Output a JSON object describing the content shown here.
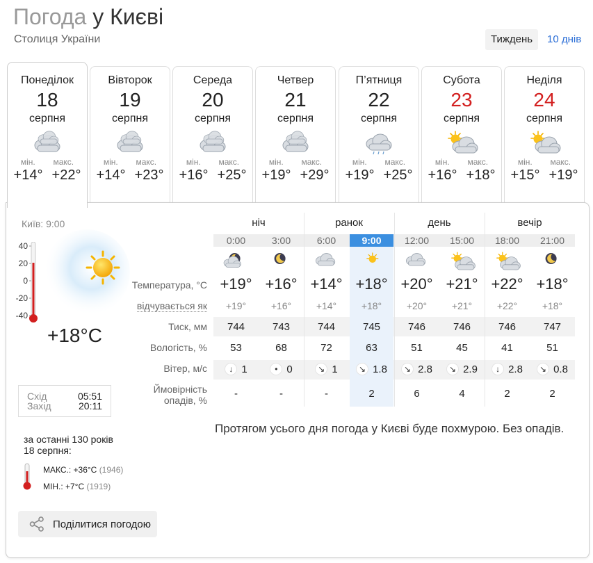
{
  "header": {
    "title_part1": "Погода",
    "title_part2": "у Києві",
    "subtitle": "Столиця України",
    "view_week": "Тиждень",
    "view_10days": "10 днів"
  },
  "days": [
    {
      "name": "Понеділок",
      "num": "18",
      "month": "серпня",
      "min_label": "мін.",
      "max_label": "макс.",
      "min": "+14°",
      "max": "+22°",
      "icon": "cloudy-icon",
      "weekend": false
    },
    {
      "name": "Вівторок",
      "num": "19",
      "month": "серпня",
      "min_label": "мін.",
      "max_label": "макс.",
      "min": "+14°",
      "max": "+23°",
      "icon": "cloudy-icon",
      "weekend": false
    },
    {
      "name": "Середа",
      "num": "20",
      "month": "серпня",
      "min_label": "мін.",
      "max_label": "макс.",
      "min": "+16°",
      "max": "+25°",
      "icon": "cloudy-icon",
      "weekend": false
    },
    {
      "name": "Четвер",
      "num": "21",
      "month": "серпня",
      "min_label": "мін.",
      "max_label": "макс.",
      "min": "+19°",
      "max": "+29°",
      "icon": "cloudy-icon",
      "weekend": false
    },
    {
      "name": "П’ятниця",
      "num": "22",
      "month": "серпня",
      "min_label": "мін.",
      "max_label": "макс.",
      "min": "+19°",
      "max": "+25°",
      "icon": "cloudy-rain-icon",
      "weekend": false
    },
    {
      "name": "Субота",
      "num": "23",
      "month": "серпня",
      "min_label": "мін.",
      "max_label": "макс.",
      "min": "+16°",
      "max": "+18°",
      "icon": "partly-cloudy-icon",
      "weekend": true
    },
    {
      "name": "Неділя",
      "num": "24",
      "month": "серпня",
      "min_label": "мін.",
      "max_label": "макс.",
      "min": "+15°",
      "max": "+19°",
      "icon": "partly-cloudy-icon",
      "weekend": true
    }
  ],
  "current": {
    "city_time": "Київ: 9:00",
    "temp": "+18°C",
    "scale": [
      "40",
      "20",
      "0",
      "-20",
      "-40"
    ],
    "sunrise_label": "Схід",
    "sunrise": "05:51",
    "sunset_label": "Захід",
    "sunset": "20:11"
  },
  "history": {
    "title_line1": "за останні 130 років",
    "title_line2": "18 серпня:",
    "max_label": "МАКС.: +36°C",
    "max_year": "(1946)",
    "min_label": "МІН.: +7°C",
    "min_year": "(1919)"
  },
  "share_label": "Поділитися погодою",
  "periods": [
    "ніч",
    "ранок",
    "день",
    "вечір"
  ],
  "row_labels": {
    "temp": "Температура, °C",
    "feels": "відчувається як",
    "pressure": "Тиск, мм",
    "humidity": "Вологість, %",
    "wind": "Вітер, м/с",
    "precip1": "Ймовірність",
    "precip2": "опадів, %"
  },
  "hours": [
    {
      "time": "0:00",
      "icon": "night-cloudy-icon",
      "temp": "+19°",
      "feels": "+19°",
      "pressure": "744",
      "humidity": "53",
      "wind_dir": "↓",
      "wind": "1",
      "precip": "-"
    },
    {
      "time": "3:00",
      "icon": "night-clear-icon",
      "temp": "+16°",
      "feels": "+16°",
      "pressure": "743",
      "humidity": "68",
      "wind_dir": "•",
      "wind": "0",
      "precip": "-"
    },
    {
      "time": "6:00",
      "icon": "cloud-icon",
      "temp": "+14°",
      "feels": "+14°",
      "pressure": "744",
      "humidity": "72",
      "wind_dir": "↘",
      "wind": "1",
      "precip": "-"
    },
    {
      "time": "9:00",
      "icon": "sun-icon",
      "temp": "+18°",
      "feels": "+18°",
      "pressure": "745",
      "humidity": "63",
      "wind_dir": "↘",
      "wind": "1.8",
      "precip": "2"
    },
    {
      "time": "12:00",
      "icon": "cloud-icon",
      "temp": "+20°",
      "feels": "+20°",
      "pressure": "746",
      "humidity": "51",
      "wind_dir": "↘",
      "wind": "2.8",
      "precip": "6"
    },
    {
      "time": "15:00",
      "icon": "partly-cloudy-icon",
      "temp": "+21°",
      "feels": "+21°",
      "pressure": "746",
      "humidity": "45",
      "wind_dir": "↘",
      "wind": "2.9",
      "precip": "4"
    },
    {
      "time": "18:00",
      "icon": "partly-cloudy-icon",
      "temp": "+22°",
      "feels": "+22°",
      "pressure": "746",
      "humidity": "41",
      "wind_dir": "↓",
      "wind": "2.8",
      "precip": "2"
    },
    {
      "time": "21:00",
      "icon": "night-clear-icon",
      "temp": "+18°",
      "feels": "+18°",
      "pressure": "747",
      "humidity": "51",
      "wind_dir": "↘",
      "wind": "0.8",
      "precip": "2"
    }
  ],
  "summary": "Протягом усього дня погода у Києві буде похмурою. Без опадів.",
  "colors": {
    "accent": "#2a6dd6",
    "current_hour": "#3b8fe0",
    "weekend": "#d32020",
    "highlight": "#eaf2fb"
  }
}
